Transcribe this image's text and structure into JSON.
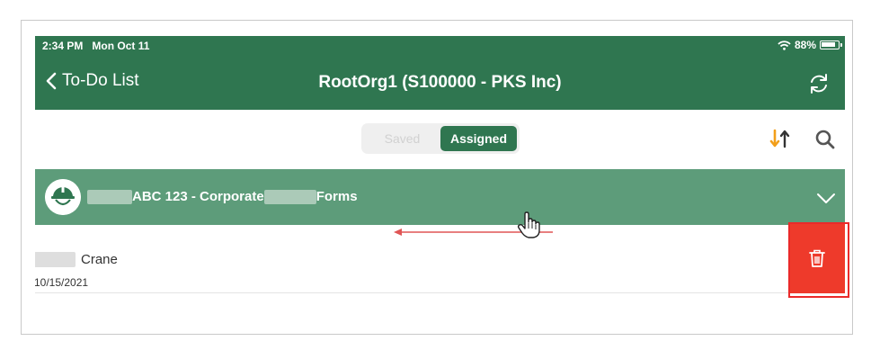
{
  "colors": {
    "brand_green": "#2f7650",
    "group_green": "#5d9c7a",
    "delete_red": "#ee3a2b",
    "sort_orange": "#f29f1a"
  },
  "status_bar": {
    "time": "2:34 PM",
    "date": "Mon Oct 11",
    "battery": "88%"
  },
  "nav": {
    "back_label": "To-Do List",
    "title": "RootOrg1 (S100000 - PKS Inc)"
  },
  "segments": {
    "saved_label": "Saved",
    "assigned_label": "Assigned",
    "selected": "Assigned"
  },
  "group": {
    "title_part1": "ABC 123 - Corporate",
    "title_part2": "Forms",
    "icon": "helmet-avatar-icon"
  },
  "row": {
    "name": "Crane",
    "date": "10/15/2021"
  },
  "icons": {
    "back": "chevron-left-icon",
    "refresh": "refresh-icon",
    "sort": "sort-icon",
    "search": "search-icon",
    "expand": "chevron-down-icon",
    "delete": "trash-icon",
    "wifi": "wifi-icon",
    "battery": "battery-icon"
  }
}
